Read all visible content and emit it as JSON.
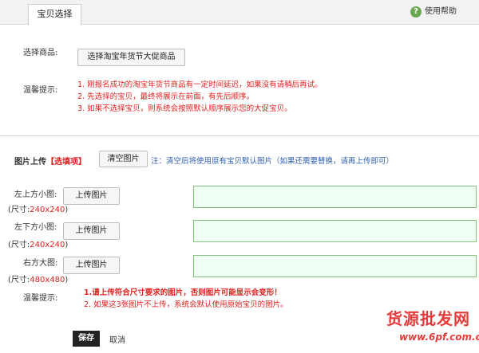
{
  "header": {
    "tab_label": "宝贝选择",
    "help_label": "使用帮助",
    "help_icon": "question-icon"
  },
  "select_section": {
    "label": "选择商品:",
    "button_label": "选择淘宝年货节大促商品",
    "tips_label": "温馨提示:",
    "tips": [
      "1. 刚报名成功的淘宝年货节商品有一定时间延迟，如果没有请稍后再试。",
      "2. 先选择的宝贝，最终将展示在前面，有先后顺序。",
      "3. 如果不选择宝贝，则系统会按照默认顺序展示您的大促宝贝。"
    ]
  },
  "upload_section": {
    "title": "图片上传",
    "title_tag": "【选填项】",
    "clear_button": "清空图片",
    "clear_note": "注：清空后将使用原有宝贝默认图片（如果还需要替换，请再上传即可）",
    "rows": [
      {
        "label": "左上方小图:",
        "size_prefix": "(尺寸:",
        "size": "240x240",
        "size_suffix": ")",
        "button": "上传图片"
      },
      {
        "label": "左下方小图:",
        "size_prefix": "(尺寸:",
        "size": "240x240",
        "size_suffix": ")",
        "button": "上传图片"
      },
      {
        "label": "右方大图:",
        "size_prefix": "(尺寸:",
        "size": "480x480",
        "size_suffix": ")",
        "button": "上传图片"
      }
    ],
    "tips_label": "温馨提示:",
    "tips": [
      "1.请上传符合尺寸要求的图片，否则图片可能显示会变形！",
      "2. 如果这3张图片不上传，系统会默认使用原始宝贝的图片。"
    ]
  },
  "footer": {
    "save_label": "保存",
    "cancel_label": "取消"
  },
  "watermark": {
    "text": "货源批发网",
    "url": "www.6pf.com.cn"
  },
  "colors": {
    "accent_red": "#e02020",
    "note_blue": "#2f5fb3",
    "input_bg": "#f0fff4",
    "input_border": "#86c07e"
  }
}
